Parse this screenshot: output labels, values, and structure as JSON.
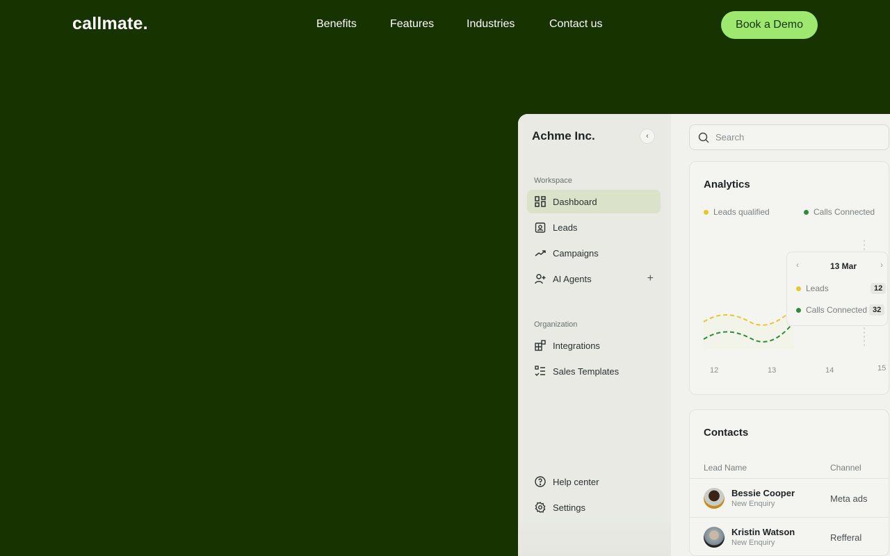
{
  "header": {
    "logo": "callmate.",
    "nav": [
      "Benefits",
      "Features",
      "Industries",
      "Contact us"
    ],
    "cta": "Book a Demo"
  },
  "sidebar": {
    "org": "Achme Inc.",
    "workspace_label": "Workspace",
    "workspace": [
      {
        "label": "Dashboard",
        "icon": "dashboard-icon",
        "active": true
      },
      {
        "label": "Leads",
        "icon": "contact-card-icon"
      },
      {
        "label": "Campaigns",
        "icon": "trend-icon"
      },
      {
        "label": "AI Agents",
        "icon": "user-plus-icon"
      }
    ],
    "org_label": "Organization",
    "organization": [
      {
        "label": "Integrations",
        "icon": "integrations-icon"
      },
      {
        "label": "Sales Templates",
        "icon": "checklist-icon"
      }
    ],
    "bottom": [
      {
        "label": "Help center",
        "icon": "help-icon"
      },
      {
        "label": "Settings",
        "icon": "gear-icon"
      }
    ]
  },
  "search": {
    "placeholder": "Search"
  },
  "analytics": {
    "title": "Analytics",
    "tooltip": {
      "date": "13 Mar",
      "leads_label": "Leads",
      "leads": "12",
      "calls_label": "Calls Connected",
      "calls": "32"
    }
  },
  "chart_data": {
    "type": "line",
    "title": "Analytics",
    "categories": [
      "12",
      "13",
      "14",
      "15"
    ],
    "series": [
      {
        "name": "Leads qualified",
        "color": "#e8c532"
      },
      {
        "name": "Calls Connected",
        "color": "#2e8b3a"
      }
    ],
    "tooltip": {
      "x": "13 Mar",
      "Leads": 12,
      "Calls Connected": 32
    }
  },
  "contacts": {
    "title": "Contacts",
    "columns": [
      "Lead Name",
      "Channel"
    ],
    "rows": [
      {
        "name": "Bessie Cooper",
        "status": "New Enquiry",
        "channel": "Meta ads"
      },
      {
        "name": "Kristin Watson",
        "status": "New Enquiry",
        "channel": "Refferal"
      }
    ]
  }
}
